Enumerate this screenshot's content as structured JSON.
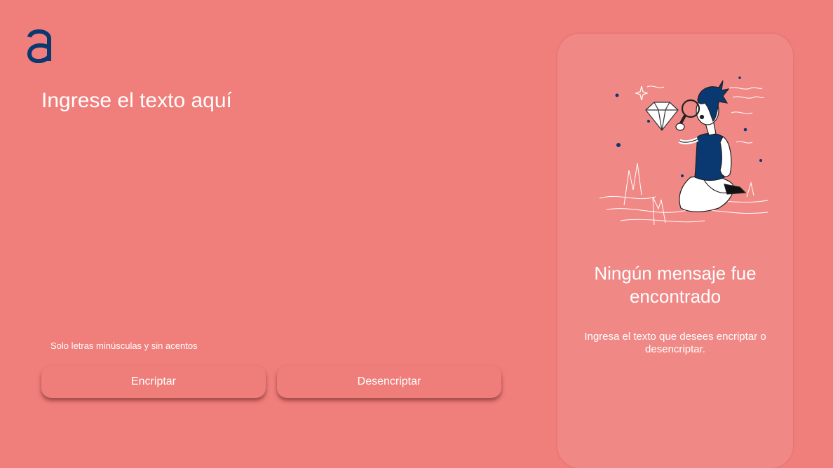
{
  "brand": {
    "logo_icon": "alura-logo-icon",
    "logo_color": "#0a3871"
  },
  "colors": {
    "background": "#f07e7b",
    "panel": "#f08886",
    "text": "#ffffff",
    "accent": "#0a3871"
  },
  "input": {
    "placeholder": "Ingrese el texto aquí",
    "value": ""
  },
  "hint": {
    "icon": "info-icon",
    "text": "Solo letras minúsculas y sin acentos"
  },
  "buttons": {
    "encrypt_label": "Encriptar",
    "decrypt_label": "Desencriptar"
  },
  "result": {
    "illustration": "person-with-magnifying-glass-illustration",
    "title": "Ningún mensaje fue encontrado",
    "text": "Ingresa el texto que desees encriptar o desencriptar."
  }
}
